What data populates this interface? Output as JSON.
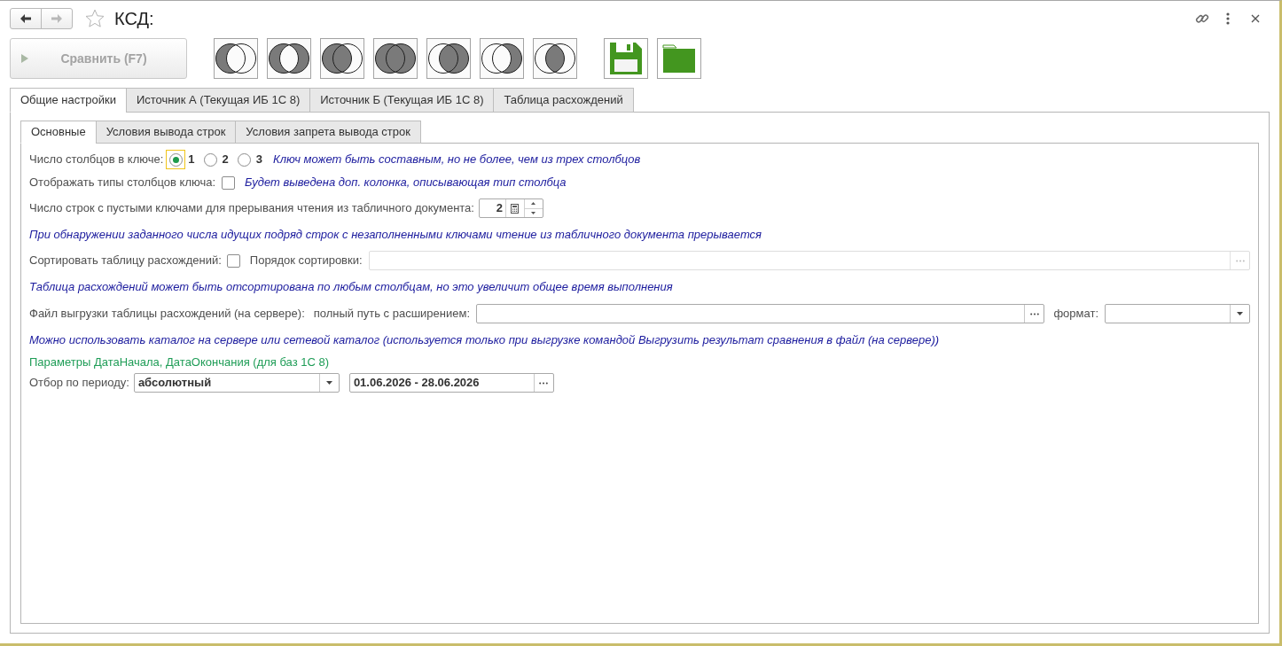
{
  "window": {
    "title": "КСД:",
    "favorite": false
  },
  "navigation": [
    {
      "kind": "back",
      "disabled": false
    },
    {
      "kind": "forward",
      "disabled": true
    }
  ],
  "toolbar": {
    "compare_button": {
      "label": "Сравнить (F7)",
      "disabled": true
    },
    "set_operation_buttons": [
      {
        "kind": "left_only"
      },
      {
        "kind": "both_sides"
      },
      {
        "kind": "left_full"
      },
      {
        "kind": "union"
      },
      {
        "kind": "right_full"
      },
      {
        "kind": "right_only"
      },
      {
        "kind": "intersection"
      }
    ],
    "file_buttons": [
      {
        "kind": "save"
      },
      {
        "kind": "folder"
      }
    ]
  },
  "tabs": [
    {
      "label": "Общие настройки",
      "selected": true
    },
    {
      "label": "Источник А (Текущая ИБ 1С 8)",
      "selected": false
    },
    {
      "label": "Источник Б (Текущая ИБ 1С 8)",
      "selected": false
    },
    {
      "label": "Таблица расхождений",
      "selected": false
    }
  ],
  "subtabs": [
    {
      "label": "Основные",
      "selected": true
    },
    {
      "label": "Условия вывода строк",
      "selected": false
    },
    {
      "label": "Условия запрета вывода строк",
      "selected": false
    }
  ],
  "form": {
    "rows": [
      {
        "kind": "radio",
        "label": "Число столбцов в ключе:",
        "options": [
          {
            "label": "1",
            "selected": true,
            "focused": true
          },
          {
            "label": "2",
            "selected": false,
            "focused": false
          },
          {
            "label": "3",
            "selected": false,
            "focused": false
          }
        ],
        "note": "Ключ может быть составным, но не более, чем из трех столбцов"
      },
      {
        "kind": "checkbox",
        "label": "Отображать типы столбцов ключа:",
        "checked": false,
        "note": "Будет выведена доп. колонка, описывающая тип столбца"
      },
      {
        "kind": "number",
        "label": "Число строк с пустыми ключами для прерывания чтения из табличного документа:",
        "value": "2"
      },
      {
        "kind": "note",
        "text": "При обнаружении заданного числа идущих подряд строк с незаполненными ключами чтение из табличного документа прерывается"
      },
      {
        "kind": "sort",
        "label": "Сортировать таблицу расхождений:",
        "checked": false,
        "order_label": "Порядок сортировки:",
        "order_disabled": true
      },
      {
        "kind": "note",
        "text": "Таблица расхождений может быть отсортирована по любым столбцам, но это увеличит общее время выполнения"
      },
      {
        "kind": "file",
        "label": "Файл выгрузки таблицы расхождений (на сервере):",
        "path_label": "полный путь с расширением:",
        "format_label": "формат:"
      },
      {
        "kind": "note",
        "text": "Можно использовать каталог на сервере или сетевой каталог (используется только при выгрузке командой Выгрузить результат сравнения в файл (на сервере))"
      },
      {
        "kind": "caption",
        "text": "Параметры ДатаНачала, ДатаОкончания (для баз 1С 8)"
      },
      {
        "kind": "period",
        "label": "Отбор по периоду:",
        "mode": "абсолютный",
        "range": "01.06.2026 - 28.06.2026"
      }
    ]
  }
}
